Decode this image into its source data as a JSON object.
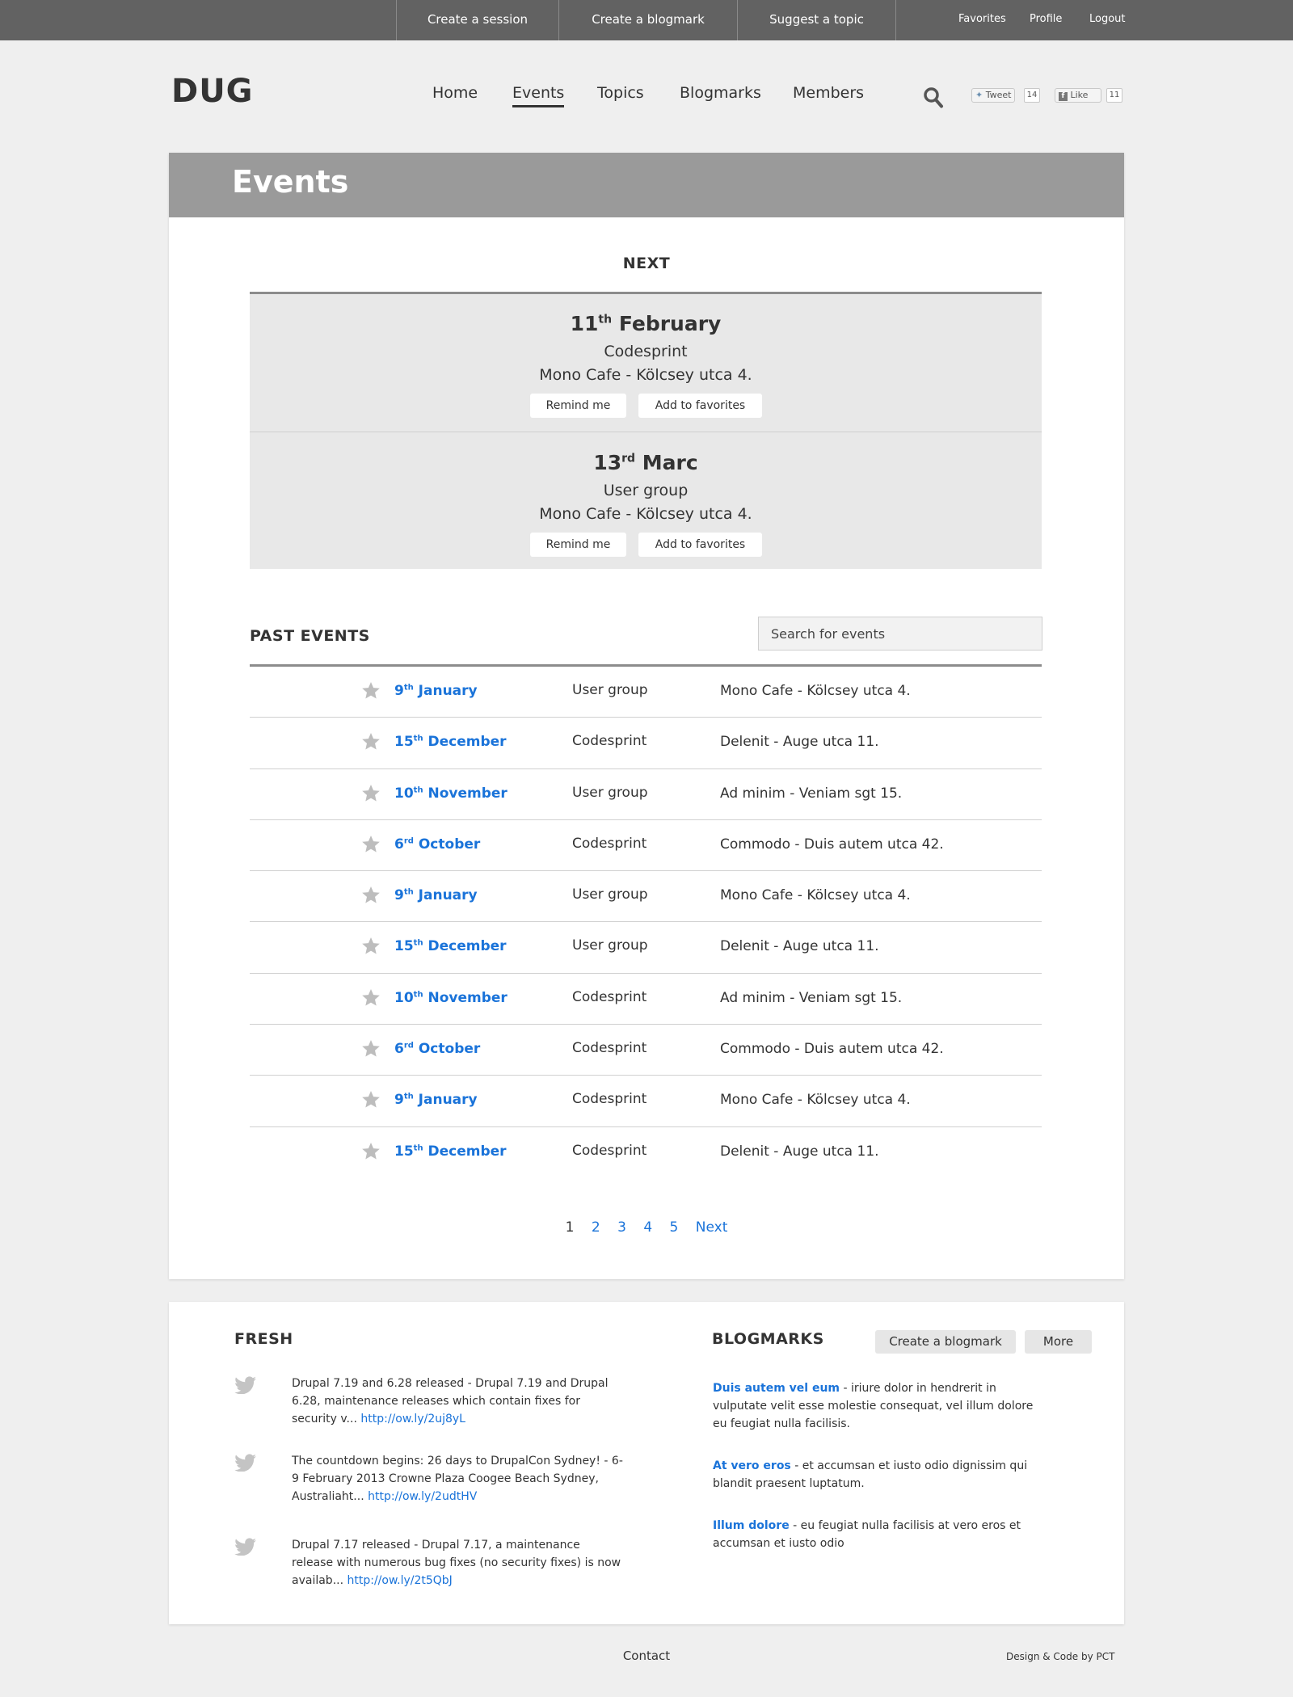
{
  "topbar": {
    "actions": [
      "Create a session",
      "Create a blogmark",
      "Suggest a topic"
    ],
    "utility": [
      "Favorites",
      "Profile",
      "Logout"
    ]
  },
  "header": {
    "logo": "DUG",
    "nav": [
      "Home",
      "Events",
      "Topics",
      "Blogmarks",
      "Members"
    ],
    "active_nav": "Events",
    "tweet_label": "Tweet",
    "tweet_count": "14",
    "like_label": "Like",
    "like_count": "11"
  },
  "events": {
    "title": "Events",
    "next_heading": "NEXT",
    "next_items": [
      {
        "day": "11",
        "suffix": "th",
        "month": "February",
        "type": "Codesprint",
        "place": "Mono Cafe - Kölcsey utca 4.",
        "remind": "Remind me",
        "favorite": "Add to favorites"
      },
      {
        "day": "13",
        "suffix": "rd",
        "month": "Marc",
        "type": "User group",
        "place": "Mono Cafe - Kölcsey utca 4.",
        "remind": "Remind me",
        "favorite": "Add to favorites"
      }
    ],
    "past_heading": "PAST EVENTS",
    "search_placeholder": "Search for events",
    "past_items": [
      {
        "day": "9",
        "suffix": "th",
        "month": "January",
        "type": "User group",
        "place": "Mono Cafe - Kölcsey utca 4."
      },
      {
        "day": "15",
        "suffix": "th",
        "month": "December",
        "type": "Codesprint",
        "place": "Delenit - Auge utca 11."
      },
      {
        "day": "10",
        "suffix": "th",
        "month": "November",
        "type": "User group",
        "place": "Ad minim  - Veniam sgt 15."
      },
      {
        "day": "6",
        "suffix": "rd",
        "month": "October",
        "type": "Codesprint",
        "place": "Commodo - Duis autem utca 42."
      },
      {
        "day": "9",
        "suffix": "th",
        "month": "January",
        "type": "User group",
        "place": "Mono Cafe - Kölcsey utca 4."
      },
      {
        "day": "15",
        "suffix": "th",
        "month": "December",
        "type": "User group",
        "place": "Delenit - Auge utca 11."
      },
      {
        "day": "10",
        "suffix": "th",
        "month": "November",
        "type": "Codesprint",
        "place": "Ad minim  - Veniam sgt 15."
      },
      {
        "day": "6",
        "suffix": "rd",
        "month": "October",
        "type": "Codesprint",
        "place": "Commodo - Duis autem utca 42."
      },
      {
        "day": "9",
        "suffix": "th",
        "month": "January",
        "type": "Codesprint",
        "place": "Mono Cafe - Kölcsey utca 4."
      },
      {
        "day": "15",
        "suffix": "th",
        "month": "December",
        "type": "Codesprint",
        "place": "Delenit - Auge utca 11."
      }
    ],
    "pagination": {
      "current": "1",
      "pages": [
        "2",
        "3",
        "4",
        "5"
      ],
      "next": "Next"
    }
  },
  "fresh": {
    "heading": "FRESH",
    "tweets": [
      {
        "text": "Drupal 7.19 and 6.28 released - Drupal 7.19 and Drupal 6.28, maintenance releases which contain fixes for security v... ",
        "link": "http://ow.ly/2uj8yL"
      },
      {
        "text": "The countdown begins: 26 days to DrupalCon Sydney! - 6-9 February 2013 Crowne Plaza Coogee Beach Sydney, Australiaht... ",
        "link": "http://ow.ly/2udtHV"
      },
      {
        "text": "Drupal 7.17 released - Drupal 7.17, a maintenance release with numerous bug fixes (no security fixes) is now availab... ",
        "link": "http://ow.ly/2t5QbJ"
      }
    ]
  },
  "blogmarks": {
    "heading": "BLOGMARKS",
    "create_label": "Create a blogmark",
    "more_label": "More",
    "items": [
      {
        "title": "Duis autem vel eum",
        "text": " - iriure dolor in hendrerit in vulputate velit esse molestie consequat, vel illum dolore eu feugiat nulla facilisis."
      },
      {
        "title": "At vero eros",
        "text": " - et accumsan et iusto odio dignissim qui blandit praesent luptatum."
      },
      {
        "title": "Illum dolore",
        "text": " - eu feugiat nulla facilisis at vero eros et accumsan et iusto odio"
      }
    ]
  },
  "footer": {
    "contact": "Contact",
    "credit": "Design & Code by PCT"
  },
  "colors": {
    "topbar": "#626262",
    "link": "#1a73d9",
    "events_header": "#9a9a9a",
    "next_box": "#e8e8e8"
  }
}
